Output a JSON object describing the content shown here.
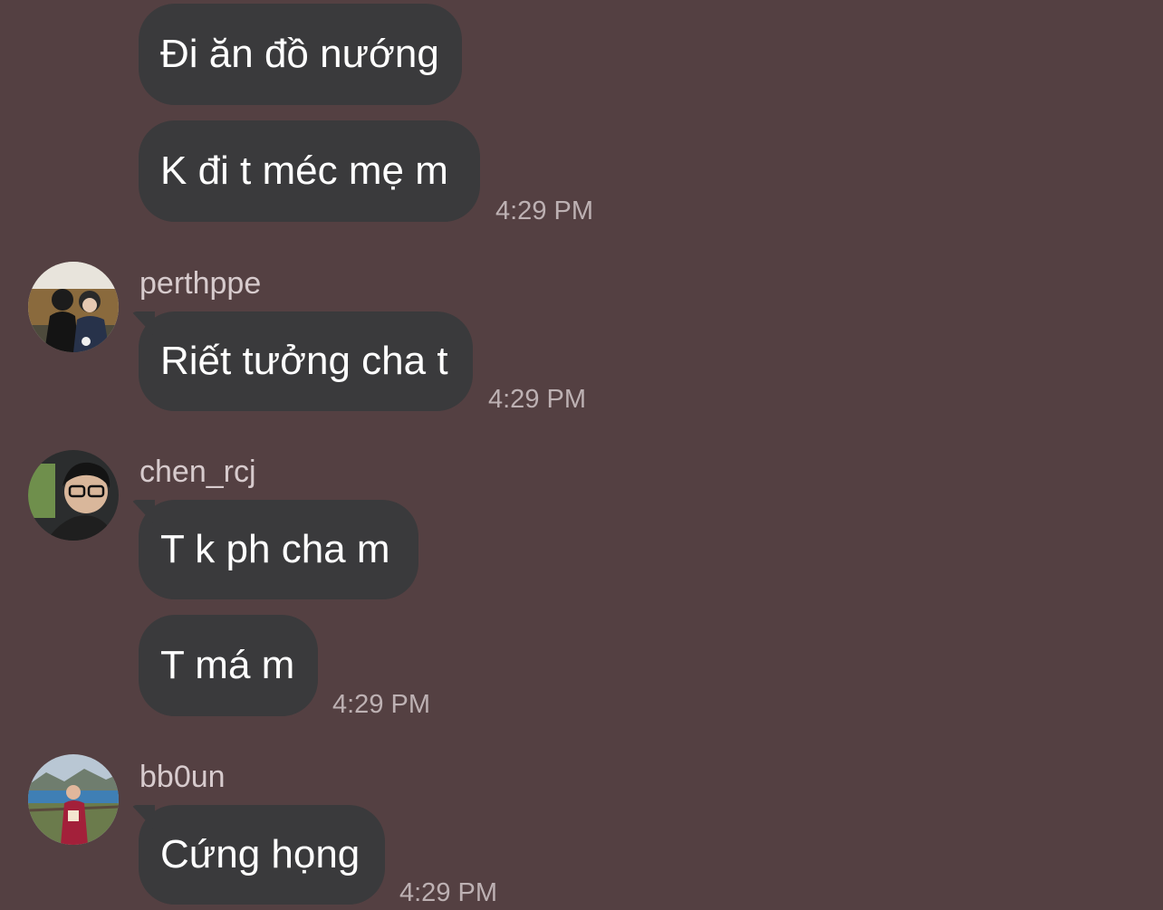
{
  "messages": [
    {
      "text": "Đi ăn đồ nướng"
    },
    {
      "text": "K đi t méc mẹ m",
      "time": "4:29 PM"
    },
    {
      "sender": "perthppe",
      "text": "Riết tưởng cha t",
      "time": "4:29 PM"
    },
    {
      "sender": "chen_rcj",
      "text": "T k ph cha m"
    },
    {
      "text": "T má m",
      "time": "4:29 PM"
    },
    {
      "sender": "bb0un",
      "text": "Cứng họng",
      "time": "4:29 PM"
    }
  ],
  "colors": {
    "background": "#544042",
    "bubble": "#3a3a3c",
    "bubble_text": "#ffffff",
    "timestamp": "#bdb1b3",
    "sender_name": "#d7cbcd"
  }
}
